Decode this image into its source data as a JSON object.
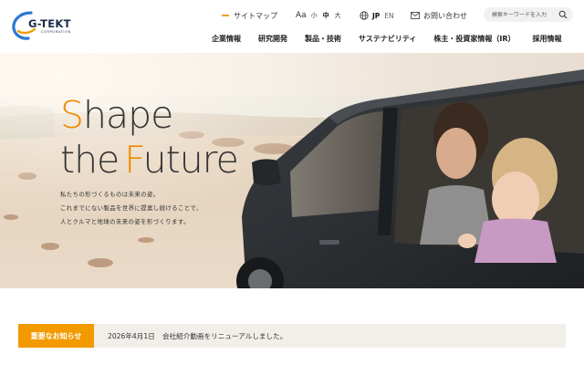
{
  "brand": {
    "name": "G-TEKT",
    "subtitle": "CORPORATION",
    "accent_color": "#f39a00",
    "logo_blue": "#1e6fc8"
  },
  "utility": {
    "sitemap": "サイトマップ",
    "font_size_label": "Aa",
    "font_sizes": [
      "小",
      "中",
      "大"
    ],
    "font_size_selected": "中",
    "lang_active": "JP",
    "lang_other": "EN",
    "contact": "お問い合わせ",
    "search_placeholder": "検索キーワードを入力"
  },
  "nav": {
    "items": [
      "企業情報",
      "研究開発",
      "製品・技術",
      "サステナビリティ",
      "株主・投資家情報（IR）",
      "採用情報"
    ]
  },
  "hero": {
    "tagline_line1_initial": "S",
    "tagline_line1_rest": "hape",
    "tagline_line2_prefix": "the",
    "tagline_line2_initial": "F",
    "tagline_line2_rest": "uture",
    "copy_lines": [
      "私たちの形づくるものは未来の姿。",
      "これまでにない製品を世界に提案し続けることで、",
      "人とクルマと地球の未来の姿を形づくります。"
    ]
  },
  "notice": {
    "badge": "重要なお知らせ",
    "date": "2026年4月1日",
    "text": "会社紹介動画をリニューアルしました。"
  }
}
